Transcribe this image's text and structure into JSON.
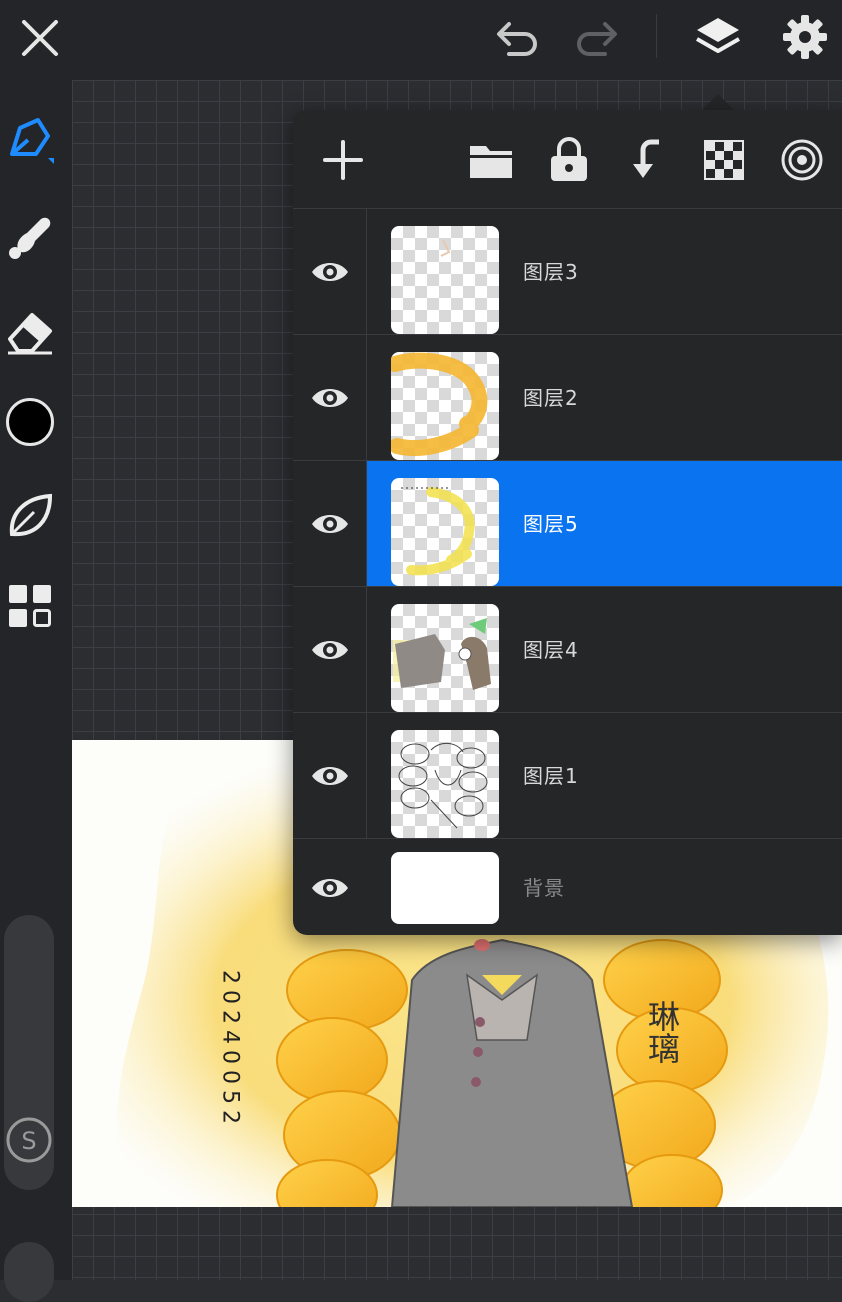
{
  "toolbar": {
    "close_icon": "close-icon",
    "undo_icon": "undo-icon",
    "redo_icon": "redo-icon",
    "layers_icon": "layers-icon",
    "settings_icon": "gear-icon"
  },
  "tools": [
    "pen-icon",
    "smudge-icon",
    "eraser-icon",
    "color-swatch",
    "leaf-icon",
    "grid-menu-icon"
  ],
  "colors": {
    "accent": "#0a74f0",
    "current_color": "#000000",
    "panel": "#252628"
  },
  "layers_panel": {
    "actions": [
      "add-icon",
      "folder-icon",
      "lock-icon",
      "merge-down-icon",
      "transparency-icon",
      "blend-icon"
    ],
    "layers": [
      {
        "name": "图层3",
        "visible": true,
        "active": false
      },
      {
        "name": "图层2",
        "visible": true,
        "active": false
      },
      {
        "name": "图层5",
        "visible": true,
        "active": true
      },
      {
        "name": "图层4",
        "visible": true,
        "active": false
      },
      {
        "name": "图层1",
        "visible": true,
        "active": false
      },
      {
        "name": "背景",
        "visible": true,
        "active": false
      }
    ]
  },
  "artwork": {
    "date_text": "20240052",
    "signature_text": "琳璃"
  }
}
